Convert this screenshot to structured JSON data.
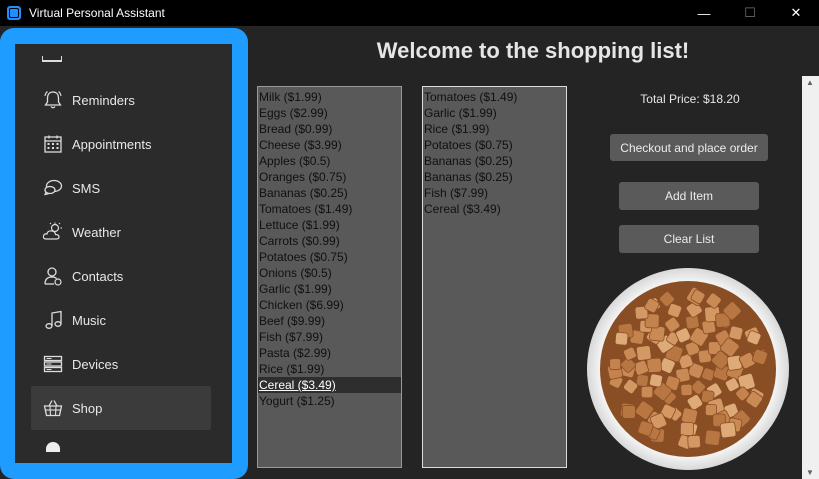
{
  "window": {
    "title": "Virtual Personal Assistant",
    "minimize": "—",
    "maximize": "☐",
    "close": "✕"
  },
  "sidebar": {
    "items": [
      {
        "label": "Reminders",
        "icon": "bell-icon"
      },
      {
        "label": "Appointments",
        "icon": "calendar-icon"
      },
      {
        "label": "SMS",
        "icon": "chat-icon"
      },
      {
        "label": "Weather",
        "icon": "weather-icon"
      },
      {
        "label": "Contacts",
        "icon": "contact-icon"
      },
      {
        "label": "Music",
        "icon": "music-icon"
      },
      {
        "label": "Devices",
        "icon": "devices-icon"
      },
      {
        "label": "Shop",
        "icon": "basket-icon"
      }
    ],
    "active": "Shop",
    "accent": "#1f9cff"
  },
  "main": {
    "heading": "Welcome to the shopping list!",
    "total": "Total Price: $18.20",
    "buttons": {
      "checkout": "Checkout and place order",
      "add": "Add Item",
      "clear": "Clear List"
    },
    "products": [
      "Milk ($1.99)",
      "Eggs ($2.99)",
      "Bread ($0.99)",
      "Cheese ($3.99)",
      "Apples ($0.5)",
      "Oranges ($0.75)",
      "Bananas ($0.25)",
      "Tomatoes ($1.49)",
      "Lettuce ($1.99)",
      "Carrots ($0.99)",
      "Potatoes ($0.75)",
      "Onions ($0.5)",
      "Garlic ($1.99)",
      "Chicken ($6.99)",
      "Beef ($9.99)",
      "Fish ($7.99)",
      "Pasta ($2.99)",
      "Rice ($1.99)",
      "Cereal ($3.49)",
      "Yogurt ($1.25)"
    ],
    "selected_product": "Cereal ($3.49)",
    "cart": [
      "Tomatoes ($1.49)",
      "Garlic ($1.99)",
      "Rice ($1.99)",
      "Potatoes ($0.75)",
      "Bananas ($0.25)",
      "Bananas ($0.25)",
      "Fish ($7.99)",
      "Cereal ($3.49)"
    ]
  }
}
